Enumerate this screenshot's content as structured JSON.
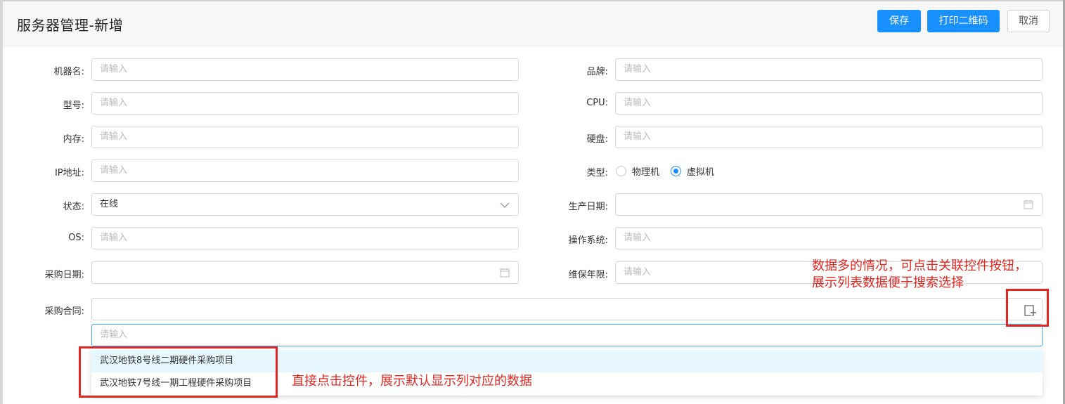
{
  "header": {
    "title": "服务器管理-新增",
    "save_label": "保存",
    "print_qr_label": "打印二维码",
    "cancel_label": "取消"
  },
  "form": {
    "machine_name": {
      "label": "机器名:",
      "placeholder": "请输入"
    },
    "brand": {
      "label": "品牌:",
      "placeholder": "请输入"
    },
    "model": {
      "label": "型号:",
      "placeholder": "请输入"
    },
    "cpu": {
      "label": "CPU:",
      "placeholder": "请输入"
    },
    "memory": {
      "label": "内存:",
      "placeholder": "请输入"
    },
    "disk": {
      "label": "硬盘:",
      "placeholder": "请输入"
    },
    "ip": {
      "label": "IP地址:",
      "placeholder": "请输入"
    },
    "type": {
      "label": "类型:",
      "options": [
        "物理机",
        "虚拟机"
      ],
      "selected": "虚拟机"
    },
    "status": {
      "label": "状态:",
      "value": "在线"
    },
    "production_date": {
      "label": "生产日期:",
      "value": ""
    },
    "os": {
      "label": "OS:",
      "placeholder": "请输入"
    },
    "operating_system": {
      "label": "操作系统:",
      "placeholder": "请输入"
    },
    "purchase_date": {
      "label": "采购日期:",
      "value": ""
    },
    "warranty_years": {
      "label": "维保年限:",
      "placeholder": "请输入"
    },
    "purchase_contract": {
      "label": "采购合同:",
      "value": ""
    },
    "contract_search": {
      "placeholder": "请输入"
    }
  },
  "dropdown": {
    "items": [
      "武汉地铁8号线二期硬件采购项目",
      "武汉地铁7号线一期工程硬件采购项目"
    ]
  },
  "annotations": {
    "note_right_line1": "数据多的情况，可点击关联控件按钮，",
    "note_right_line2": "展示列表数据便于搜索选择",
    "note_bottom": "直接点击控件，展示默认显示列对应的数据"
  },
  "colors": {
    "primary": "#1890ff",
    "annotation_red": "#e52620",
    "active_item_bg": "#e6f7ff"
  },
  "icons": {
    "dropdown_arrow": "chevron-down-icon",
    "date": "calendar-icon",
    "related_add": "add-related-icon"
  }
}
